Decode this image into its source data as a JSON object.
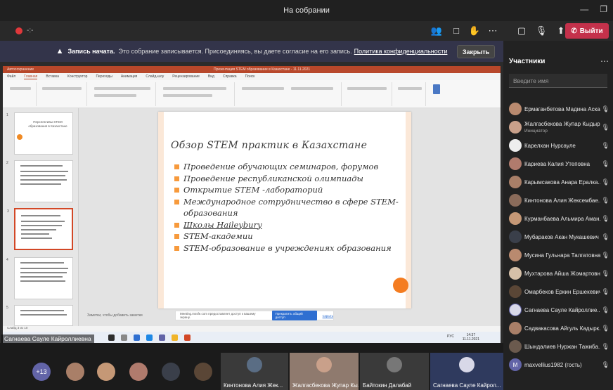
{
  "window": {
    "title": "На собрании",
    "minimize": "—",
    "maximize": "❐"
  },
  "meeting": {
    "timer": "-:-",
    "leave_label": "Выйти",
    "leave_icon": "phone-icon",
    "tools": [
      "people-icon",
      "chat-icon",
      "raise-hand-icon",
      "more-icon",
      "camera-off-icon",
      "mic-off-icon",
      "share-icon"
    ]
  },
  "banner": {
    "strong": "Запись начата.",
    "text": "Это собрание записывается. Присоединяясь, вы даете согласие на его запись.",
    "link": "Политика конфиденциальности",
    "close_label": "Закрыть"
  },
  "powerpoint": {
    "autosave": "Автосохранение",
    "doc_title": "Презентация STEM образование в Казахстане - 11.11.2021",
    "menu": [
      "Файл",
      "Главная",
      "Вставка",
      "Конструктор",
      "Переходы",
      "Анимация",
      "Слайд-шоу",
      "Рецензирование",
      "Вид",
      "Справка",
      "Поиск"
    ],
    "menu_active": 1,
    "thumb_titles": [
      "Перспективы STEM образования в Казахстане"
    ],
    "slide": {
      "title": "Обзор STEM практик в Казахстане",
      "bullets": [
        "Проведение обучающих семинаров, форумов",
        "Проведение республиканской олимпиады",
        "Открытие STEM -лабораторий",
        "Международное сотрудничество в сфере STEM-образования",
        "Школы Haileybury",
        "STEM-академии",
        "STEM-образование в учреждениях образования"
      ]
    },
    "notes_placeholder": "Заметки, чтобы добавить заметки",
    "share_msg": "Meeting.mssfe.com предоставляет доступ к вашему экрану.",
    "share_btn": "Прекратить общий доступ",
    "share_hide": "Скрыть",
    "status": "Слайд 3 из 10",
    "clock_time": "14:37",
    "clock_date": "11.11.2021",
    "lang": "РУС"
  },
  "presenter_label": "Сагнаева Сауле Кайроллиевна",
  "strip": {
    "more_count": "+13",
    "tiles": [
      {
        "name": "Кинтонова Алия Жек...",
        "color": "#5a6d84"
      },
      {
        "name": "Жалгасбекова Жупар Кы...",
        "color": "#a47b66"
      },
      {
        "name": "Байтокин Далабай",
        "color": "#6a6a6a"
      },
      {
        "name": "Сагнаева Сауле Кайрол...",
        "color": "#3b4a7a"
      }
    ]
  },
  "participants": {
    "header": "Участники",
    "invite_placeholder": "Введите имя",
    "list": [
      {
        "name": "Ермаганбетова Мадина Аска...",
        "role": ""
      },
      {
        "name": "Жалгасбекова Жупар Кыдыр...",
        "role": "Инициатор"
      },
      {
        "name": "Карелхан Нурсауле",
        "role": ""
      },
      {
        "name": "Кариева Калия Утеповна",
        "role": ""
      },
      {
        "name": "Карымсакова Анара Ералка...",
        "role": ""
      },
      {
        "name": "Кинтонова Алия Жексембае...",
        "role": ""
      },
      {
        "name": "Курманбаева Альмира Аман...",
        "role": ""
      },
      {
        "name": "Мубараков Акан Мукашевич",
        "role": ""
      },
      {
        "name": "Мусина Гульнара Талгатовна",
        "role": ""
      },
      {
        "name": "Мухтарова Айша Жомартовна",
        "role": ""
      },
      {
        "name": "Омарбеков Еркин Ершекевич",
        "role": ""
      },
      {
        "name": "Сагнаева Сауле Кайроллие...",
        "role": ""
      },
      {
        "name": "Садвакасова Айгуль Кадырк...",
        "role": ""
      },
      {
        "name": "Шындалиев Нуржан Тажиба...",
        "role": ""
      },
      {
        "name": "maxvellius1982 (гость)",
        "role": ""
      }
    ]
  },
  "colors": {
    "accent": "#6264a7",
    "leave": "#c4314b",
    "ppt": "#b7472a",
    "bullet": "#f79a3c"
  }
}
